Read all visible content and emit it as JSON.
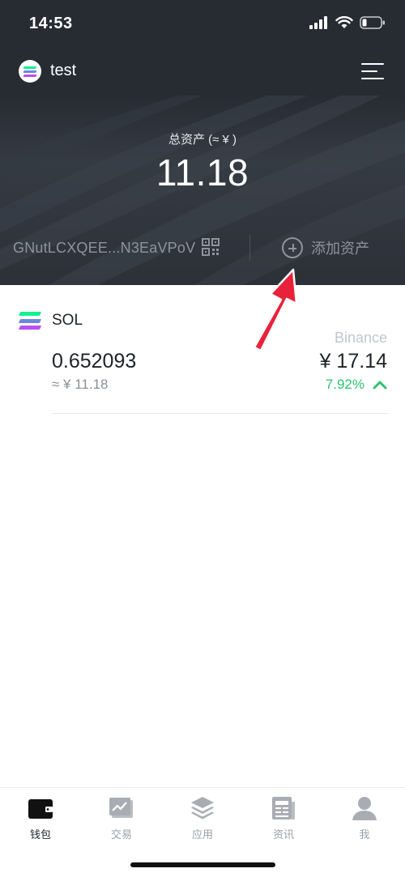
{
  "status_bar": {
    "time": "14:53"
  },
  "header": {
    "wallet_name": "test"
  },
  "summary": {
    "total_label": "总资产 (≈ ¥ )",
    "total_value": "11.18",
    "address": "GNutLCXQEE...N3EaVPoV",
    "add_asset_label": "添加资产"
  },
  "assets": [
    {
      "symbol": "SOL",
      "price_source": "Binance",
      "balance": "0.652093",
      "fiat_value": "≈ ¥ 11.18",
      "price": "¥ 17.14",
      "change": "7.92%"
    }
  ],
  "tabs": [
    {
      "label": "钱包",
      "icon": "wallet-icon",
      "active": true
    },
    {
      "label": "交易",
      "icon": "chart-icon",
      "active": false
    },
    {
      "label": "应用",
      "icon": "layers-icon",
      "active": false
    },
    {
      "label": "资讯",
      "icon": "news-icon",
      "active": false
    },
    {
      "label": "我",
      "icon": "profile-icon",
      "active": false
    }
  ],
  "colors": {
    "header_bg": "#272c33",
    "positive": "#2ac46e",
    "arrow": "#e8223a",
    "sol_gradient": [
      "#14f195",
      "#6d87e0",
      "#b94ff0"
    ]
  }
}
